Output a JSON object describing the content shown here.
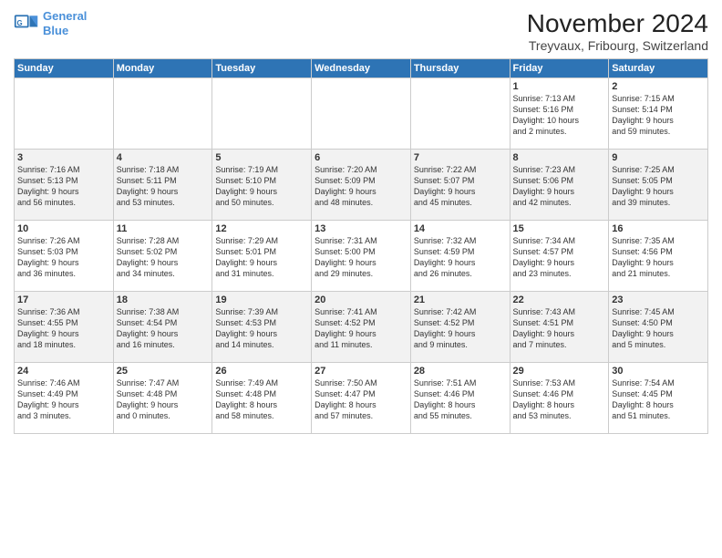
{
  "logo": {
    "line1": "General",
    "line2": "Blue"
  },
  "title": "November 2024",
  "location": "Treyvaux, Fribourg, Switzerland",
  "weekdays": [
    "Sunday",
    "Monday",
    "Tuesday",
    "Wednesday",
    "Thursday",
    "Friday",
    "Saturday"
  ],
  "weeks": [
    [
      {
        "day": "",
        "info": ""
      },
      {
        "day": "",
        "info": ""
      },
      {
        "day": "",
        "info": ""
      },
      {
        "day": "",
        "info": ""
      },
      {
        "day": "",
        "info": ""
      },
      {
        "day": "1",
        "info": "Sunrise: 7:13 AM\nSunset: 5:16 PM\nDaylight: 10 hours\nand 2 minutes."
      },
      {
        "day": "2",
        "info": "Sunrise: 7:15 AM\nSunset: 5:14 PM\nDaylight: 9 hours\nand 59 minutes."
      }
    ],
    [
      {
        "day": "3",
        "info": "Sunrise: 7:16 AM\nSunset: 5:13 PM\nDaylight: 9 hours\nand 56 minutes."
      },
      {
        "day": "4",
        "info": "Sunrise: 7:18 AM\nSunset: 5:11 PM\nDaylight: 9 hours\nand 53 minutes."
      },
      {
        "day": "5",
        "info": "Sunrise: 7:19 AM\nSunset: 5:10 PM\nDaylight: 9 hours\nand 50 minutes."
      },
      {
        "day": "6",
        "info": "Sunrise: 7:20 AM\nSunset: 5:09 PM\nDaylight: 9 hours\nand 48 minutes."
      },
      {
        "day": "7",
        "info": "Sunrise: 7:22 AM\nSunset: 5:07 PM\nDaylight: 9 hours\nand 45 minutes."
      },
      {
        "day": "8",
        "info": "Sunrise: 7:23 AM\nSunset: 5:06 PM\nDaylight: 9 hours\nand 42 minutes."
      },
      {
        "day": "9",
        "info": "Sunrise: 7:25 AM\nSunset: 5:05 PM\nDaylight: 9 hours\nand 39 minutes."
      }
    ],
    [
      {
        "day": "10",
        "info": "Sunrise: 7:26 AM\nSunset: 5:03 PM\nDaylight: 9 hours\nand 36 minutes."
      },
      {
        "day": "11",
        "info": "Sunrise: 7:28 AM\nSunset: 5:02 PM\nDaylight: 9 hours\nand 34 minutes."
      },
      {
        "day": "12",
        "info": "Sunrise: 7:29 AM\nSunset: 5:01 PM\nDaylight: 9 hours\nand 31 minutes."
      },
      {
        "day": "13",
        "info": "Sunrise: 7:31 AM\nSunset: 5:00 PM\nDaylight: 9 hours\nand 29 minutes."
      },
      {
        "day": "14",
        "info": "Sunrise: 7:32 AM\nSunset: 4:59 PM\nDaylight: 9 hours\nand 26 minutes."
      },
      {
        "day": "15",
        "info": "Sunrise: 7:34 AM\nSunset: 4:57 PM\nDaylight: 9 hours\nand 23 minutes."
      },
      {
        "day": "16",
        "info": "Sunrise: 7:35 AM\nSunset: 4:56 PM\nDaylight: 9 hours\nand 21 minutes."
      }
    ],
    [
      {
        "day": "17",
        "info": "Sunrise: 7:36 AM\nSunset: 4:55 PM\nDaylight: 9 hours\nand 18 minutes."
      },
      {
        "day": "18",
        "info": "Sunrise: 7:38 AM\nSunset: 4:54 PM\nDaylight: 9 hours\nand 16 minutes."
      },
      {
        "day": "19",
        "info": "Sunrise: 7:39 AM\nSunset: 4:53 PM\nDaylight: 9 hours\nand 14 minutes."
      },
      {
        "day": "20",
        "info": "Sunrise: 7:41 AM\nSunset: 4:52 PM\nDaylight: 9 hours\nand 11 minutes."
      },
      {
        "day": "21",
        "info": "Sunrise: 7:42 AM\nSunset: 4:52 PM\nDaylight: 9 hours\nand 9 minutes."
      },
      {
        "day": "22",
        "info": "Sunrise: 7:43 AM\nSunset: 4:51 PM\nDaylight: 9 hours\nand 7 minutes."
      },
      {
        "day": "23",
        "info": "Sunrise: 7:45 AM\nSunset: 4:50 PM\nDaylight: 9 hours\nand 5 minutes."
      }
    ],
    [
      {
        "day": "24",
        "info": "Sunrise: 7:46 AM\nSunset: 4:49 PM\nDaylight: 9 hours\nand 3 minutes."
      },
      {
        "day": "25",
        "info": "Sunrise: 7:47 AM\nSunset: 4:48 PM\nDaylight: 9 hours\nand 0 minutes."
      },
      {
        "day": "26",
        "info": "Sunrise: 7:49 AM\nSunset: 4:48 PM\nDaylight: 8 hours\nand 58 minutes."
      },
      {
        "day": "27",
        "info": "Sunrise: 7:50 AM\nSunset: 4:47 PM\nDaylight: 8 hours\nand 57 minutes."
      },
      {
        "day": "28",
        "info": "Sunrise: 7:51 AM\nSunset: 4:46 PM\nDaylight: 8 hours\nand 55 minutes."
      },
      {
        "day": "29",
        "info": "Sunrise: 7:53 AM\nSunset: 4:46 PM\nDaylight: 8 hours\nand 53 minutes."
      },
      {
        "day": "30",
        "info": "Sunrise: 7:54 AM\nSunset: 4:45 PM\nDaylight: 8 hours\nand 51 minutes."
      }
    ]
  ]
}
